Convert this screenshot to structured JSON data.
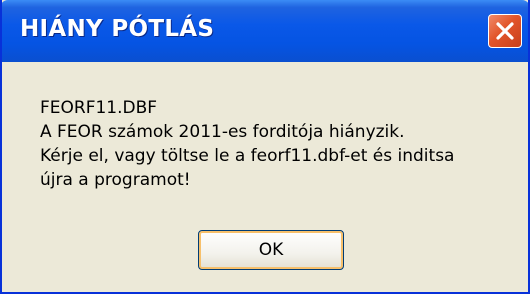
{
  "dialog": {
    "title": "HIÁNY PÓTLÁS",
    "message_lines": [
      "FEORF11.DBF",
      "A FEOR számok 2011-es forditója hiányzik.",
      "Kérje el, vagy töltse le a feorf11.dbf-et és inditsa",
      "újra a programot!"
    ],
    "ok_label": "OK",
    "close_icon": "close-icon"
  },
  "colors": {
    "titlebar": "#0554e3",
    "close_button": "#e2552a",
    "body": "#ece9d8"
  }
}
